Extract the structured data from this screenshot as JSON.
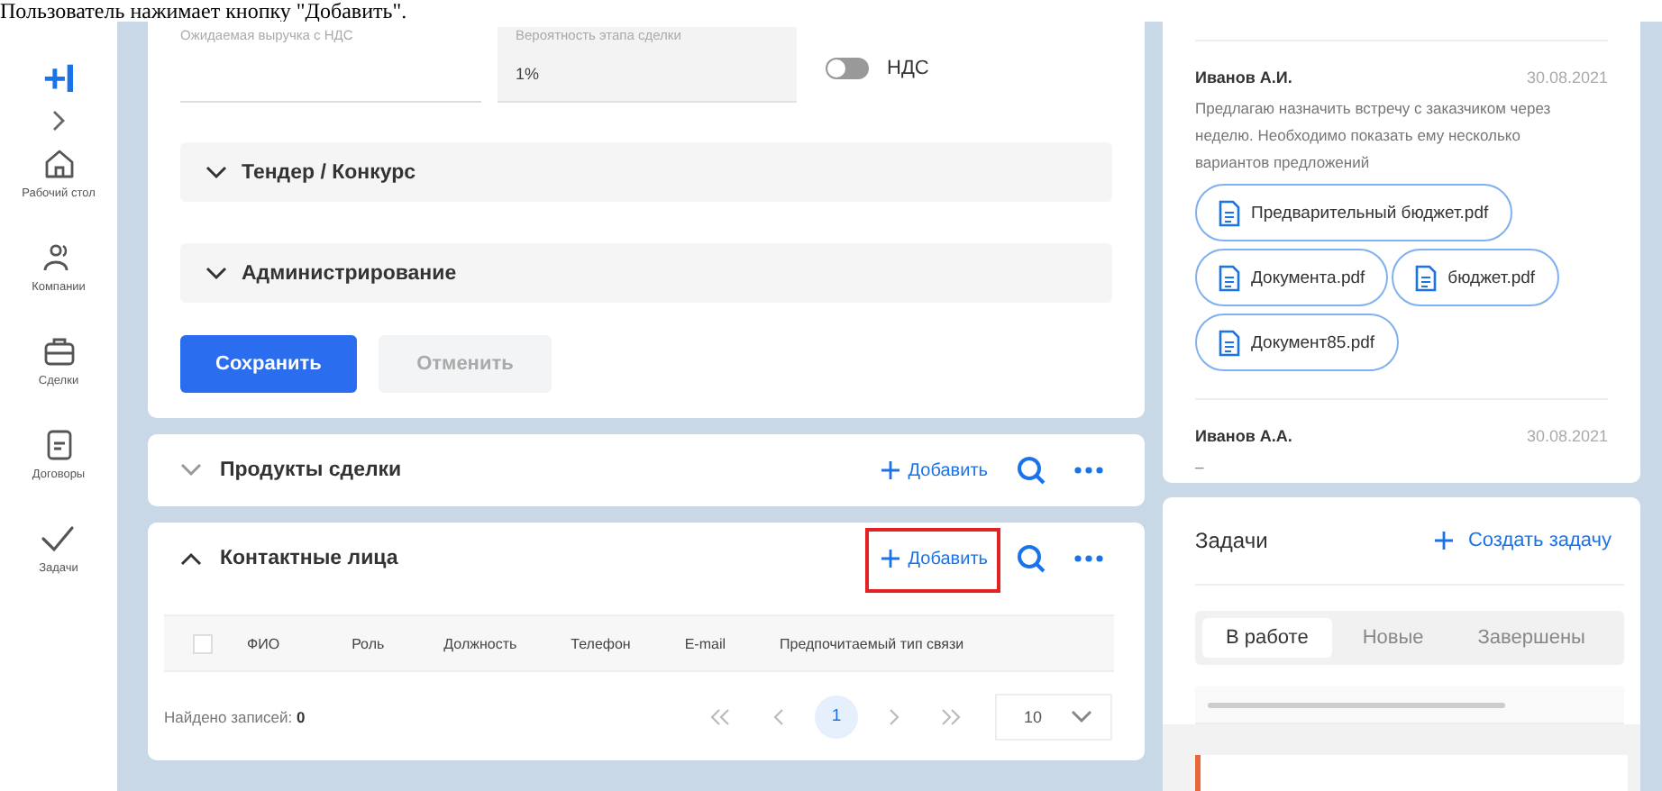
{
  "caption": "Пользователь нажимает кнопку \"Добавить\".",
  "sidebar": {
    "logo": "+I",
    "items": [
      {
        "label": "Рабочий стол",
        "kind": "home"
      },
      {
        "label": "Компании",
        "kind": "people"
      },
      {
        "label": "Сделки",
        "kind": "briefcase"
      },
      {
        "label": "Договоры",
        "kind": "document"
      },
      {
        "label": "Задачи",
        "kind": "check"
      }
    ]
  },
  "deal_form": {
    "fields": [
      {
        "kind": "line",
        "label": "Ожидаемая выручка с НДС"
      },
      {
        "kind": "filled",
        "label": "Вероятность этапа сделки",
        "value": "1%"
      }
    ],
    "vat_toggle": {
      "label": "НДС",
      "on": false
    },
    "sections": [
      {
        "title": "Тендер / Конкурс",
        "expanded": false
      },
      {
        "title": "Администрирование",
        "expanded": false
      }
    ],
    "buttons": [
      {
        "label": "Сохранить",
        "kind": "primary"
      },
      {
        "label": "Отменить",
        "kind": "secondary"
      }
    ]
  },
  "panels": [
    {
      "title": "Продукты сделки",
      "expanded": false,
      "add_label": "Добавить",
      "highlighted": false
    },
    {
      "title": "Контактные лица",
      "expanded": true,
      "add_label": "Добавить",
      "highlighted": true,
      "table": {
        "select_all_checked": false,
        "columns": [
          "ФИО",
          "Роль",
          "Должность",
          "Телефон",
          "E-mail",
          "Предпочитаемый тип связи"
        ],
        "found": "Найдено записей: **0**",
        "pages": [
          {
            "label": "1",
            "selected": true
          }
        ],
        "page_size": "10"
      }
    }
  ],
  "comments": [
    {
      "author": "Иванов А.И.",
      "date": "30.08.2021",
      "text": "Предлагаю назначить встречу с заказчиком через неделю. Необходимо показать ему несколько вариантов предложений",
      "files": [
        "Предварительный бюджет.pdf",
        "Документа.pdf",
        "бюджет.pdf",
        "Документ85.pdf"
      ]
    },
    {
      "author": "Иванов А.А.",
      "date": "30.08.2021",
      "text": "–"
    }
  ],
  "tasks": {
    "title": "Задачи",
    "create_label": "Создать задачу",
    "tabs": [
      {
        "label": "В работе",
        "selected": true
      },
      {
        "label": "Новые",
        "selected": false
      },
      {
        "label": "Завершены",
        "selected": false
      }
    ]
  }
}
